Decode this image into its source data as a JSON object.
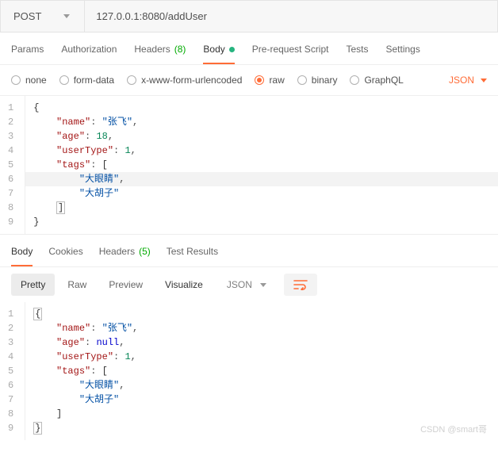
{
  "request": {
    "method": "POST",
    "url": "127.0.0.1:8080/addUser"
  },
  "tabs": {
    "params": "Params",
    "auth": "Authorization",
    "headers": "Headers",
    "headers_count": "(8)",
    "body": "Body",
    "prs": "Pre-request Script",
    "tests": "Tests",
    "settings": "Settings"
  },
  "body_types": {
    "none": "none",
    "formdata": "form-data",
    "urlenc": "x-www-form-urlencoded",
    "raw": "raw",
    "binary": "binary",
    "graphql": "GraphQL",
    "lang": "JSON"
  },
  "req_body": {
    "name_key": "\"name\"",
    "name_val": "\"张飞\"",
    "age_key": "\"age\"",
    "age_val": "18",
    "ut_key": "\"userType\"",
    "ut_val": "1",
    "tags_key": "\"tags\"",
    "tag1": "\"大眼睛\"",
    "tag2": "\"大胡子\""
  },
  "resp_tabs": {
    "body": "Body",
    "cookies": "Cookies",
    "headers": "Headers",
    "headers_count": "(5)",
    "tests": "Test Results"
  },
  "views": {
    "pretty": "Pretty",
    "raw": "Raw",
    "preview": "Preview",
    "visualize": "Visualize",
    "lang": "JSON"
  },
  "resp_body": {
    "name_key": "\"name\"",
    "name_val": "\"张飞\"",
    "age_key": "\"age\"",
    "age_val": "null",
    "ut_key": "\"userType\"",
    "ut_val": "1",
    "tags_key": "\"tags\"",
    "tag1": "\"大眼睛\"",
    "tag2": "\"大胡子\""
  },
  "watermark": "CSDN @smart哥"
}
